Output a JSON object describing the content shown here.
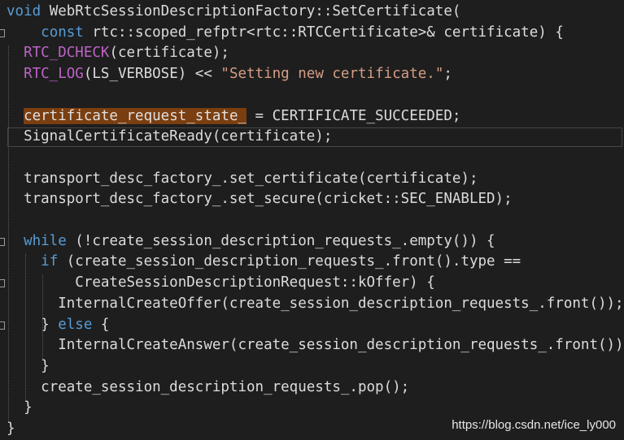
{
  "code_lines": [
    {
      "parts": [
        {
          "t": "void",
          "c": "kw"
        },
        {
          "t": " WebRtcSessionDescriptionFactory::SetCertificate("
        }
      ]
    },
    {
      "parts": [
        {
          "t": "    "
        },
        {
          "t": "const",
          "c": "kw"
        },
        {
          "t": " rtc::scoped_refptr<rtc::RTCCertificate>& certificate) {"
        }
      ]
    },
    {
      "parts": [
        {
          "t": "  "
        },
        {
          "t": "RTC_DCHECK",
          "c": "macro"
        },
        {
          "t": "(certificate);"
        }
      ]
    },
    {
      "parts": [
        {
          "t": "  "
        },
        {
          "t": "RTC_LOG",
          "c": "macro"
        },
        {
          "t": "(LS_VERBOSE) << "
        },
        {
          "t": "\"Setting new certificate.\"",
          "c": "str"
        },
        {
          "t": ";"
        }
      ]
    },
    {
      "parts": [
        {
          "t": ""
        }
      ]
    },
    {
      "parts": [
        {
          "t": "  "
        },
        {
          "t": "certificate_request_state_",
          "c": "hl"
        },
        {
          "t": " = CERTIFICATE_SUCCEEDED;"
        }
      ]
    },
    {
      "parts": [
        {
          "t": "  SignalCertificateReady(certificate);"
        }
      ]
    },
    {
      "parts": [
        {
          "t": ""
        }
      ]
    },
    {
      "parts": [
        {
          "t": "  transport_desc_factory_.set_certificate(certificate);"
        }
      ]
    },
    {
      "parts": [
        {
          "t": "  transport_desc_factory_.set_secure(cricket::SEC_ENABLED);"
        }
      ]
    },
    {
      "parts": [
        {
          "t": ""
        }
      ]
    },
    {
      "parts": [
        {
          "t": "  "
        },
        {
          "t": "while",
          "c": "kw"
        },
        {
          "t": " (!create_session_description_requests_.empty()) {"
        }
      ]
    },
    {
      "parts": [
        {
          "t": "    "
        },
        {
          "t": "if",
          "c": "kw"
        },
        {
          "t": " (create_session_description_requests_.front().type =="
        }
      ]
    },
    {
      "parts": [
        {
          "t": "        CreateSessionDescriptionRequest::kOffer) {"
        }
      ]
    },
    {
      "parts": [
        {
          "t": "      InternalCreateOffer(create_session_description_requests_.front());"
        }
      ]
    },
    {
      "parts": [
        {
          "t": "    } "
        },
        {
          "t": "else",
          "c": "kw"
        },
        {
          "t": " {"
        }
      ]
    },
    {
      "parts": [
        {
          "t": "      InternalCreateAnswer(create_session_description_requests_.front());"
        }
      ]
    },
    {
      "parts": [
        {
          "t": "    }"
        }
      ]
    },
    {
      "parts": [
        {
          "t": "    create_session_description_requests_.pop();"
        }
      ]
    },
    {
      "parts": [
        {
          "t": "  }"
        }
      ]
    },
    {
      "parts": [
        {
          "t": "}"
        }
      ]
    }
  ],
  "current_line": 6,
  "folded_lines": [
    1,
    11,
    13,
    15
  ],
  "watermark": "https://blog.csdn.net/ice_ly000",
  "colors": {
    "background": "#1e1e1e",
    "keyword": "#569cd6",
    "macro": "#bd63c5",
    "string": "#d69d85",
    "highlight": "#7a3e10"
  }
}
